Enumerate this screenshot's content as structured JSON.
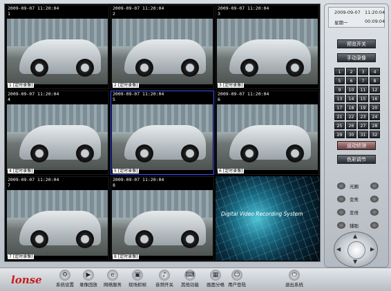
{
  "cameras": [
    {
      "timestamp": "2009-09-07  11:20:04",
      "number": "1",
      "label": "1 [定时录像]"
    },
    {
      "timestamp": "2009-09-07  11:20:04",
      "number": "2",
      "label": "2 [定时录像]"
    },
    {
      "timestamp": "2009-09-07  11:20:04",
      "number": "3",
      "label": "3 [定时录像]"
    },
    {
      "timestamp": "2009-09-07  11:20:04",
      "number": "4",
      "label": "4 [定时录像]"
    },
    {
      "timestamp": "2009-09-07  11:20:04",
      "number": "5",
      "label": "5 [定时录像]"
    },
    {
      "timestamp": "2009-09-07  11:20:04",
      "number": "6",
      "label": "6 [定时录像]"
    },
    {
      "timestamp": "2009-09-07  11:20:04",
      "number": "7",
      "label": "7 [定时录像]"
    },
    {
      "timestamp": "2009-09-07  11:20:04",
      "number": "8",
      "label": "8 [定时录像]"
    }
  ],
  "splash": {
    "text": "Digital Video Recording System"
  },
  "clock": {
    "date": "2009-09-07",
    "time": "11:20:04",
    "weekday": "星期一",
    "elapsed": "00:09:04"
  },
  "panel": {
    "preview_toggle": "预览开关",
    "manual_record": "手动录像",
    "channels": [
      "1",
      "2",
      "3",
      "4",
      "5",
      "6",
      "7",
      "8",
      "9",
      "10",
      "11",
      "12",
      "13",
      "14",
      "15",
      "16",
      "17",
      "18",
      "19",
      "20",
      "21",
      "22",
      "23",
      "24",
      "25",
      "26",
      "27",
      "28",
      "29",
      "30",
      "31",
      "32"
    ],
    "motion_detect": "运动侦测",
    "color_adjust": "色彩调节",
    "controls": [
      "光圈",
      "变焦",
      "变倍",
      "辅助"
    ]
  },
  "toolbar": {
    "logo": "lonse",
    "items": [
      {
        "label": "系统设置",
        "icon": "gear-icon",
        "glyph": "⚙"
      },
      {
        "label": "录像回放",
        "icon": "play-icon",
        "glyph": "▶"
      },
      {
        "label": "网络服务",
        "icon": "network-icon",
        "glyph": "e"
      },
      {
        "label": "现场抓帧",
        "icon": "camera-icon",
        "glyph": "▣"
      },
      {
        "label": "音频开关",
        "icon": "audio-icon",
        "glyph": "♪"
      },
      {
        "label": "其他功能",
        "icon": "keyboard-icon",
        "glyph": "⌨"
      },
      {
        "label": "画面分格",
        "icon": "grid-icon",
        "glyph": "▦"
      },
      {
        "label": "用户登陆",
        "icon": "user-icon",
        "glyph": "☺"
      },
      {
        "label": "退出系统",
        "icon": "exit-icon",
        "glyph": "⏻"
      }
    ]
  }
}
